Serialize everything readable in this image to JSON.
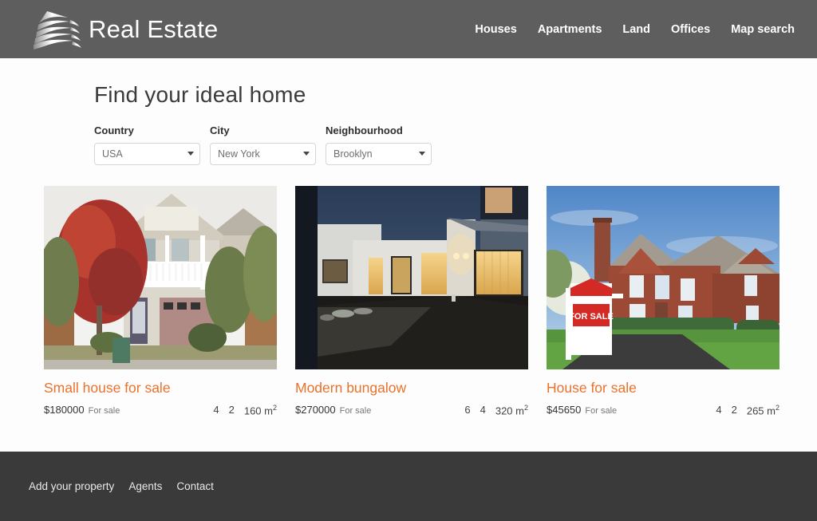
{
  "header": {
    "brand_name": "Real Estate",
    "logo_icon": "building-logo-icon",
    "nav": [
      {
        "label": "Houses"
      },
      {
        "label": "Apartments"
      },
      {
        "label": "Land"
      },
      {
        "label": "Offices"
      },
      {
        "label": "Map search"
      }
    ]
  },
  "main": {
    "title": "Find your ideal home",
    "filters": [
      {
        "label": "Country",
        "value": "USA",
        "name": "country"
      },
      {
        "label": "City",
        "value": "New York",
        "name": "city"
      },
      {
        "label": "Neighbourhood",
        "value": "Brooklyn",
        "name": "neighbourhood"
      }
    ],
    "listings": [
      {
        "title": "Small house for sale",
        "price": "$180000",
        "status": "For sale",
        "bedrooms": "4",
        "bathrooms": "2",
        "area": "160 m",
        "area_unit": "2",
        "photo": "two-story-beige-house-with-red-maple-tree"
      },
      {
        "title": "Modern bungalow",
        "price": "$270000",
        "status": "For sale",
        "bedrooms": "6",
        "bathrooms": "4",
        "area": "320 m",
        "area_unit": "2",
        "photo": "modern-courtyard-house-at-dusk"
      },
      {
        "title": "House for sale",
        "price": "$45650",
        "status": "For sale",
        "bedrooms": "4",
        "bathrooms": "2",
        "area": "265 m",
        "area_unit": "2",
        "photo": "brick-house-with-for-sale-sign"
      }
    ],
    "for_sale_sign_text": "FOR SALE"
  },
  "footer": {
    "links": [
      {
        "label": "Add your property"
      },
      {
        "label": "Agents"
      },
      {
        "label": "Contact"
      }
    ]
  },
  "colors": {
    "header_bg": "#5e5e5e",
    "footer_bg": "#3a3a3a",
    "accent": "#e8722b",
    "page_bg": "#fdfdfd"
  }
}
